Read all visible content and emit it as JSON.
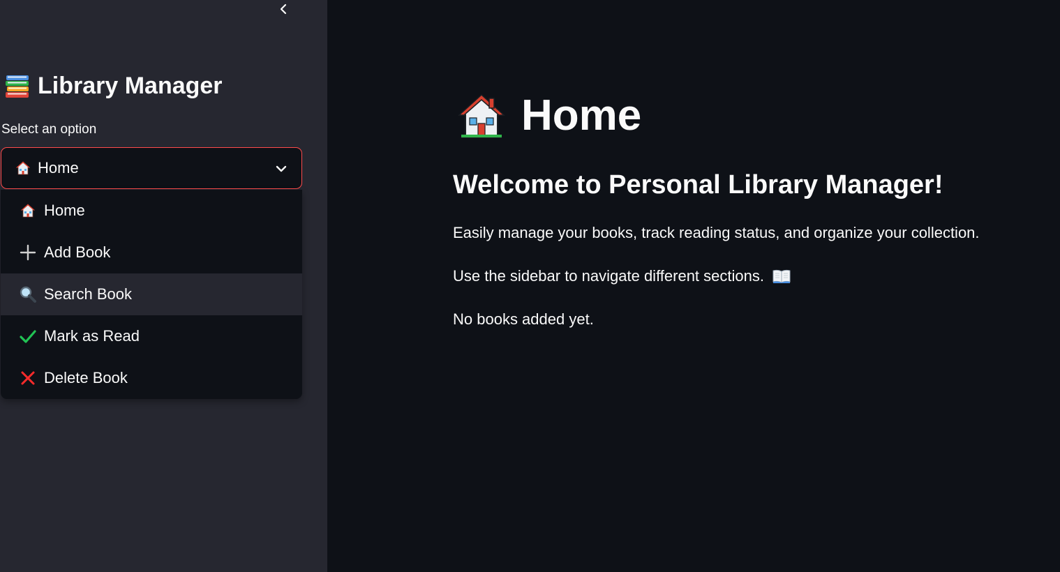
{
  "sidebar": {
    "title": "Library Manager",
    "title_icon": "books-icon",
    "select_label": "Select an option",
    "selected_value": "Home",
    "options": [
      {
        "label": "Home",
        "icon": "house-icon"
      },
      {
        "label": "Add Book",
        "icon": "plus-icon"
      },
      {
        "label": "Search Book",
        "icon": "magnifier-icon"
      },
      {
        "label": "Mark as Read",
        "icon": "check-icon"
      },
      {
        "label": "Delete Book",
        "icon": "cross-icon"
      }
    ],
    "hovered_option": "Search Book"
  },
  "main": {
    "title": "Home",
    "title_icon": "house-icon",
    "heading": "Welcome to Personal Library Manager!",
    "paragraph_1": "Easily manage your books, track reading status, and organize your collection.",
    "paragraph_2": "Use the sidebar to navigate different sections.",
    "paragraph_2_icon": "open-book-icon",
    "status_text": "No books added yet."
  },
  "colors": {
    "background": "#0e1117",
    "sidebar_bg": "#262730",
    "accent": "#ff4b4b",
    "text": "#fafafa",
    "check_green": "#21c354",
    "cross_red": "#ff2b2b"
  }
}
